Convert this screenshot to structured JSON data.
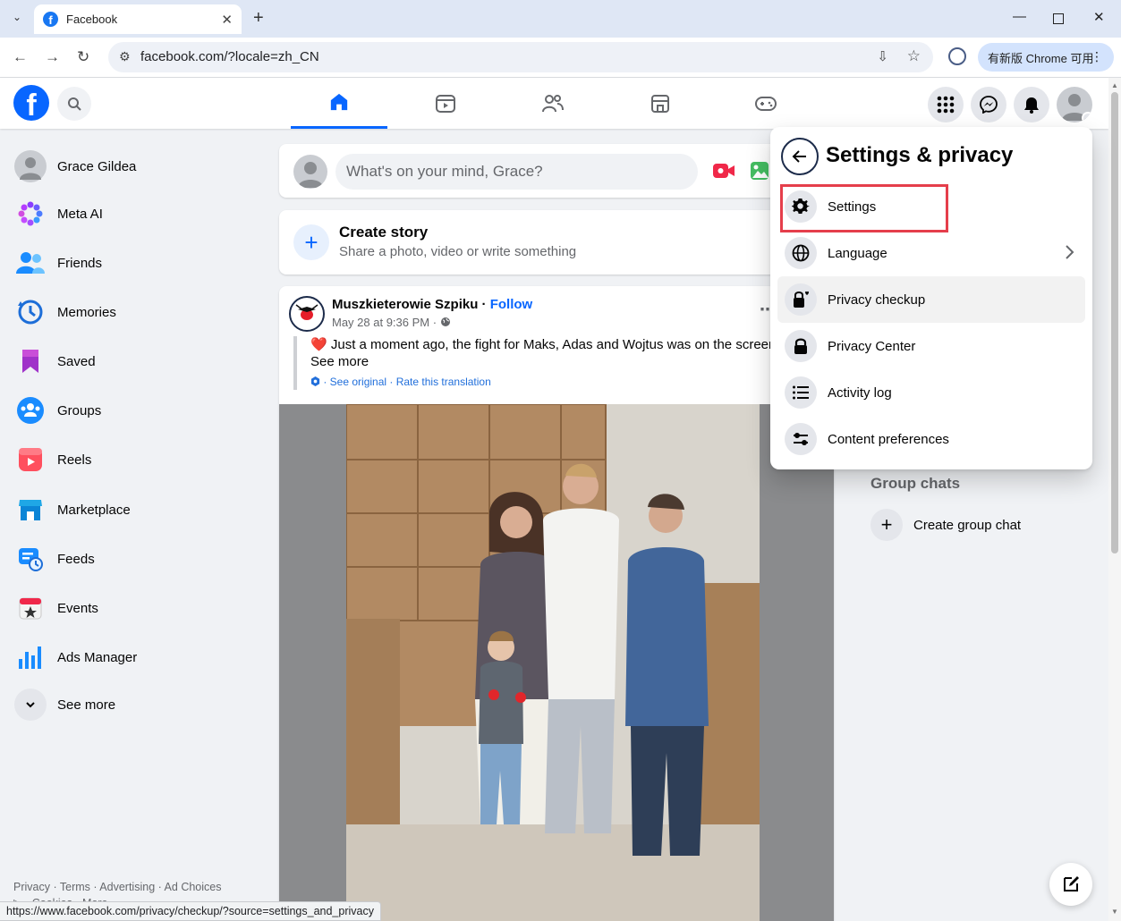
{
  "browser": {
    "tab_title": "Facebook",
    "url": "facebook.com/?locale=zh_CN",
    "update_button": "有新版 Chrome 可用",
    "status_url": "https://www.facebook.com/privacy/checkup/?source=settings_and_privacy"
  },
  "header": {
    "logo": "f",
    "nav_tabs": [
      "home",
      "video",
      "friends",
      "marketplace",
      "gaming"
    ]
  },
  "sidebar": {
    "items": [
      {
        "label": "Grace Gildea",
        "icon": "avatar"
      },
      {
        "label": "Meta AI",
        "icon": "meta-ai-icon"
      },
      {
        "label": "Friends",
        "icon": "friends-icon"
      },
      {
        "label": "Memories",
        "icon": "memories-icon"
      },
      {
        "label": "Saved",
        "icon": "saved-icon"
      },
      {
        "label": "Groups",
        "icon": "groups-icon"
      },
      {
        "label": "Reels",
        "icon": "reels-icon"
      },
      {
        "label": "Marketplace",
        "icon": "marketplace-icon"
      },
      {
        "label": "Feeds",
        "icon": "feeds-icon"
      },
      {
        "label": "Events",
        "icon": "events-icon"
      },
      {
        "label": "Ads Manager",
        "icon": "ads-manager-icon"
      },
      {
        "label": "See more",
        "icon": "chevron-down-icon"
      }
    ],
    "footer": "Privacy · Terms · Advertising · Ad Choices",
    "footer2": "▷ · Cookies · More"
  },
  "composer": {
    "placeholder": "What's on your mind, Grace?"
  },
  "story": {
    "title": "Create story",
    "subtitle": "Share a photo, video or write something"
  },
  "post": {
    "author": "Muszkieterowie Szpiku",
    "separator": " · ",
    "follow": "Follow",
    "meta": "May 28 at 9:36 PM · ",
    "body": "Just a moment ago, the fight for Maks, Adas and Wojtus was on the screen",
    "see_more": "See more",
    "translation": "· See original · Rate this translation"
  },
  "right": {
    "group_chats": "Group chats",
    "create_group": "Create group chat"
  },
  "dropdown": {
    "title": "Settings & privacy",
    "items": [
      {
        "label": "Settings",
        "icon": "gear-icon"
      },
      {
        "label": "Language",
        "icon": "globe-icon"
      },
      {
        "label": "Privacy checkup",
        "icon": "lock-heart-icon"
      },
      {
        "label": "Privacy Center",
        "icon": "lock-icon"
      },
      {
        "label": "Activity log",
        "icon": "list-icon"
      },
      {
        "label": "Content preferences",
        "icon": "sliders-icon"
      }
    ]
  },
  "colors": {
    "brand": "#0866ff",
    "highlight": "#e53e4b"
  }
}
